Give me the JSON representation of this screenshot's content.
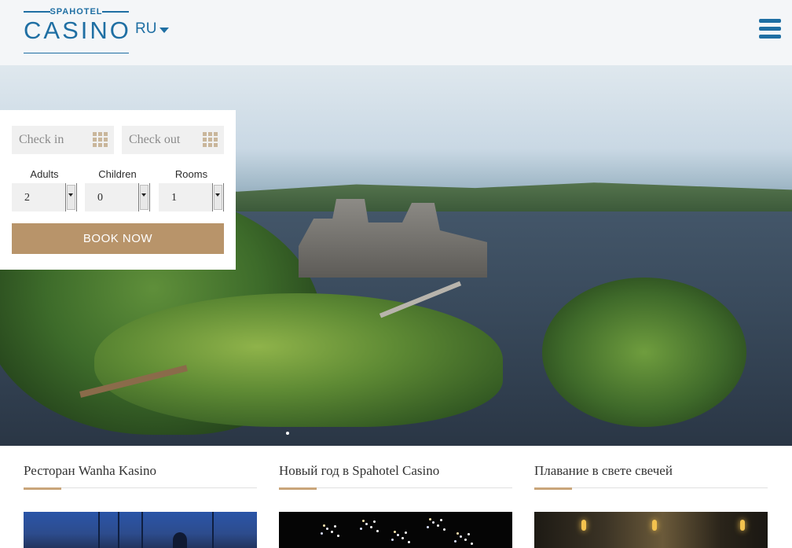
{
  "header": {
    "logo_small": "SPAHOTEL",
    "logo_big": "CASINO",
    "language": "RU",
    "language_icon": "chevron-down-icon",
    "menu_icon": "hamburger-menu-icon"
  },
  "booking": {
    "check_in_placeholder": "Check in",
    "check_out_placeholder": "Check out",
    "calendar_icon": "calendar-icon",
    "adults_label": "Adults",
    "adults_value": "2",
    "children_label": "Children",
    "children_value": "0",
    "rooms_label": "Rooms",
    "rooms_value": "1",
    "book_label": "BOOK NOW"
  },
  "articles": [
    {
      "title": "Ресторан Wanha Kasino"
    },
    {
      "title": "Новый год в Spahotel Casino"
    },
    {
      "title": "Плавание в свете свечей"
    }
  ],
  "colors": {
    "brand_blue": "#1f6fa3",
    "button_tan": "#b8946a",
    "accent_gold": "#c9a57a"
  }
}
